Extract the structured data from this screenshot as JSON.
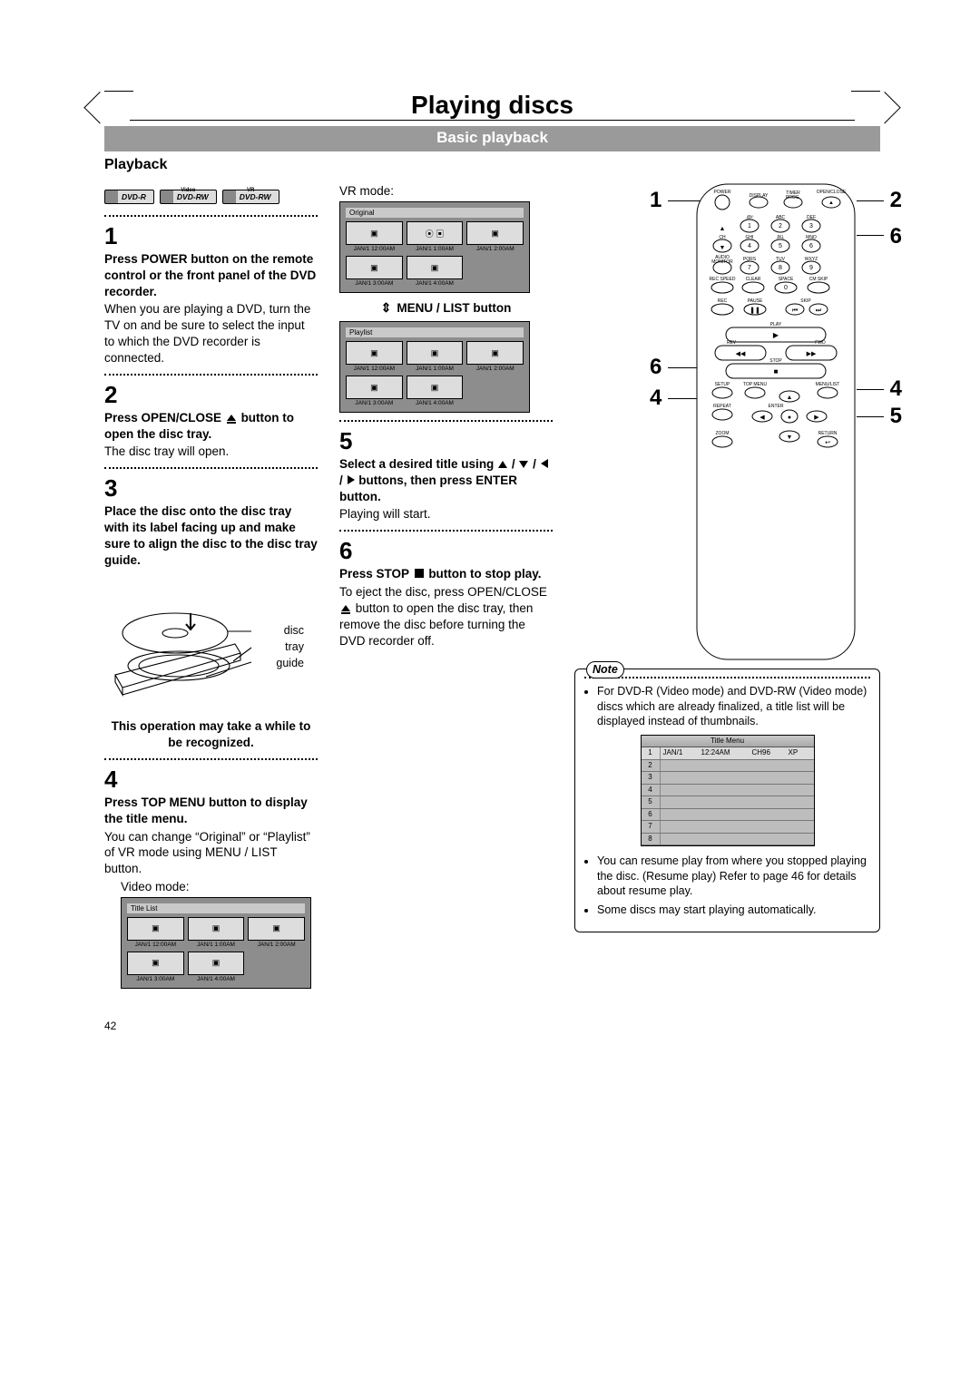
{
  "chapter_title": "Playing discs",
  "section_title": "Basic playback",
  "subsection": "Playback",
  "badges": [
    "DVD-R",
    "DVD-RW",
    "DVD-RW"
  ],
  "badge_above": [
    "",
    "Video",
    "VR"
  ],
  "col1": {
    "step1_num": "1",
    "step1_bold": "Press POWER button on the remote control or the front panel of the DVD recorder.",
    "step1_text": "When you are playing a DVD, turn the TV on and be sure to select the input to which the DVD recorder is connected.",
    "step2_num": "2",
    "step2_bold_a": "Press OPEN/CLOSE ",
    "step2_bold_b": " button to open the disc tray.",
    "step2_text": "The disc tray will open.",
    "step3_num": "3",
    "step3_bold": "Place the disc onto the disc tray with its label facing up and make sure to align the disc to the disc tray guide.",
    "tray_labels": [
      "disc",
      "tray",
      "guide"
    ],
    "caution": "This operation may take a while to be recognized.",
    "step4_num": "4",
    "step4_bold": "Press TOP MENU button to display the title menu.",
    "step4_text": "You can change “Original” or “Playlist” of  VR mode using MENU / LIST button.",
    "video_mode_label": "Video mode:",
    "osd_title_list": "Title List",
    "osd_original": "Original",
    "osd_playlist": "Playlist",
    "thumbs": [
      {
        "cap": "JAN/1   12:00AM"
      },
      {
        "cap": "JAN/1   1:00AM"
      },
      {
        "cap": "JAN/1   2:00AM"
      },
      {
        "cap": "JAN/1   3:00AM"
      },
      {
        "cap": "JAN/1   4:00AM"
      }
    ]
  },
  "col2": {
    "vr_mode_label": "VR mode:",
    "menu_list_label": "MENU / LIST button",
    "step5_num": "5",
    "step5_bold_a": "Select a desired title using ",
    "step5_bold_b": " buttons, then press ENTER button.",
    "step5_text": "Playing will start.",
    "step6_num": "6",
    "step6_bold_a": "Press STOP ",
    "step6_bold_b": " button to stop play.",
    "step6_p1": "To eject the disc, press OPEN/CLOSE ",
    "step6_p2": " button to open the disc tray, then remove the disc before turning the DVD recorder off."
  },
  "note": {
    "label": "Note",
    "bullets": [
      "For DVD-R (Video mode) and DVD-RW (Video mode) discs which are already finalized, a title list will be displayed instead of thumbnails.",
      "You can resume play from where you stopped playing the disc. (Resume play) Refer to page 46 for details about resume play.",
      "Some discs may start playing automatically."
    ],
    "title_menu_head": "Title Menu",
    "title_row": {
      "num": "1",
      "date": "JAN/1",
      "time": "12:24AM",
      "ch": "CH96",
      "q": "XP"
    }
  },
  "remote": {
    "labels": {
      "POWER": "POWER",
      "DISPLAY": "DISPLAY",
      "TIMERPROG": "TIMER\nPROG.",
      "OPENCLOSE": "OPEN/CLOSE",
      "AT": ".@/:",
      "ABC": "ABC",
      "DEF": "DEF",
      "CH": "CH",
      "GHI": "GHI",
      "JKL": "JKL",
      "MNO": "MNO",
      "AUDMON": "AUDIO\nMONITOR",
      "PQRS": "PQRS",
      "TUV": "TUV",
      "WXYZ": "WXYZ",
      "RECSPEED": "REC SPEED",
      "CLEAR": "CLEAR",
      "SPACE": "SPACE",
      "CMSKIP": "CM SKIP",
      "REC": "REC",
      "PAUSE": "PAUSE",
      "SKIP": "SKIP",
      "PLAY": "PLAY",
      "REV": "REV",
      "FWD": "FWD",
      "STOP": "STOP",
      "SETUP": "SETUP",
      "TOPMENU": "TOP MENU",
      "MENULIST": "MENU/LIST",
      "REPEAT": "REPEAT",
      "ENTER": "ENTER",
      "ZOOM": "ZOOM",
      "RETURN": "RETURN"
    },
    "nums": [
      "1",
      "2",
      "3",
      "4",
      "5",
      "6",
      "7",
      "8",
      "9",
      "0"
    ]
  },
  "callouts": {
    "l1": "1",
    "l6": "6",
    "l4": "4",
    "r2": "2",
    "r6": "6",
    "r4": "4",
    "r5": "5"
  },
  "page_number": "42"
}
